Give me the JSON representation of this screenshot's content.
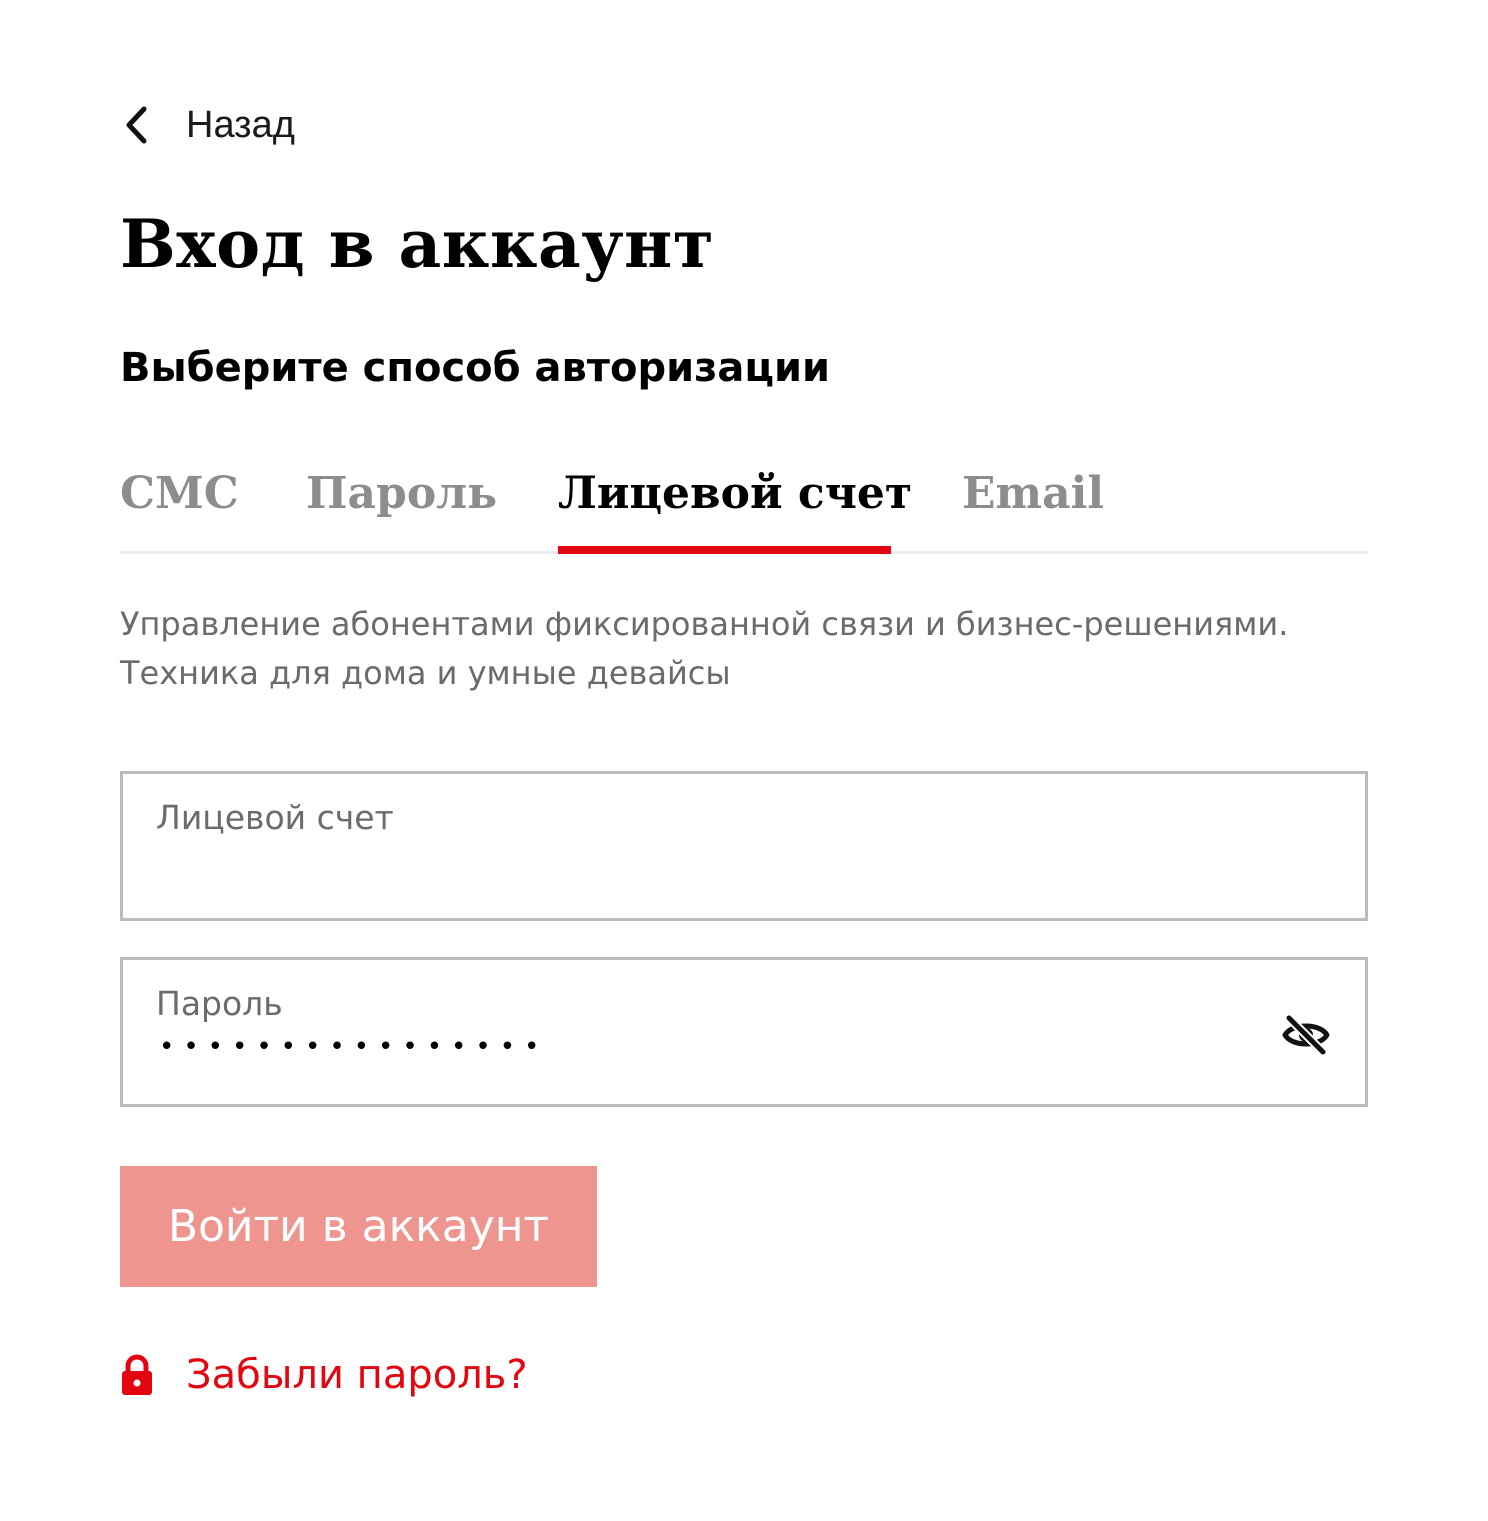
{
  "nav": {
    "back_label": "Назад"
  },
  "header": {
    "title": "Вход в аккаунт",
    "subtitle": "Выберите способ авторизации"
  },
  "tabs": [
    {
      "label": "СМС",
      "active": false
    },
    {
      "label": "Пароль",
      "active": false
    },
    {
      "label": "Лицевой счет",
      "active": true
    },
    {
      "label": "Email",
      "active": false
    }
  ],
  "description": {
    "line1": "Управление абонентами фиксированной связи и бизнес-решениями.",
    "line2": "Техника для дома и умные девайсы"
  },
  "form": {
    "account_field": {
      "label": "Лицевой счет",
      "value": ""
    },
    "password_field": {
      "label": "Пароль",
      "masked_value": "••••••••••••••••",
      "visibility_icon": "eye-off-icon"
    },
    "submit_label": "Войти в аккаунт",
    "forgot_label": "Забыли пароль?",
    "forgot_icon": "lock-icon"
  },
  "colors": {
    "accent": "#e30611",
    "submit_disabled": "#ee9590",
    "tab_inactive": "#8d8d8d",
    "border": "#bcbcbc"
  }
}
